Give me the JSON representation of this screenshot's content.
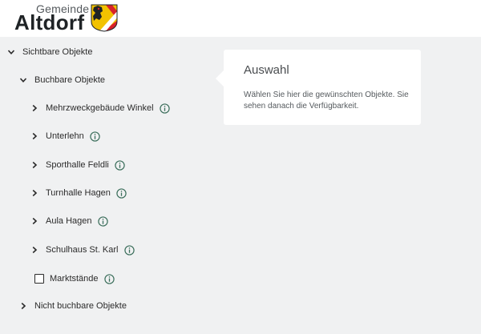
{
  "header": {
    "logo_top": "Gemeinde",
    "logo_main": "Altdorf"
  },
  "tree": {
    "root": {
      "label": "Sichtbare Objekte",
      "expanded": true
    },
    "bookable": {
      "label": "Buchbare Objekte",
      "expanded": true
    },
    "items": [
      {
        "label": "Mehrzweckgebäude Winkel",
        "type": "expandable"
      },
      {
        "label": "Unterlehn",
        "type": "expandable"
      },
      {
        "label": "Sporthalle Feldli",
        "type": "expandable"
      },
      {
        "label": "Turnhalle Hagen",
        "type": "expandable"
      },
      {
        "label": "Aula Hagen",
        "type": "expandable"
      },
      {
        "label": "Schulhaus St. Karl",
        "type": "expandable"
      },
      {
        "label": "Marktstände",
        "type": "checkbox",
        "checked": false
      }
    ],
    "non_bookable": {
      "label": "Nicht buchbare Objekte",
      "expanded": false
    }
  },
  "selection_card": {
    "title": "Auswahl",
    "text": "Wählen Sie hier die gewünschten Objekte. Sie sehen danach die Verfügbarkeit."
  },
  "colors": {
    "background": "#f0f1f2",
    "panel": "#ffffff",
    "text": "#2b2b2b",
    "info_icon": "#3c6f5c",
    "shield_red": "#d8232a",
    "shield_yellow": "#f2c200"
  },
  "icons": {
    "expanded": "chevron-down-icon",
    "collapsed": "chevron-right-icon",
    "info": "info-icon",
    "unchecked": "checkbox-icon"
  }
}
